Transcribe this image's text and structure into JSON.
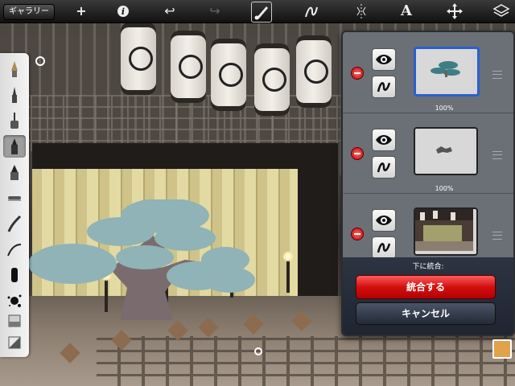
{
  "toolbar": {
    "gallery_label": "ギャラリー",
    "add_glyph": "+",
    "info_glyph": "i",
    "undo_glyph": "↩",
    "redo_glyph": "↪",
    "text_glyph": "A",
    "icons": [
      "plus-icon",
      "info-icon",
      "undo-icon",
      "redo-icon",
      "brush-icon",
      "stroke-icon",
      "symmetry-icon",
      "text-icon",
      "transform-icon",
      "layers-icon"
    ]
  },
  "toolbox": {
    "tools": [
      "pencil",
      "ballpoint",
      "airbrush",
      "marker",
      "paint-brush",
      "smudge",
      "inking-pen",
      "calligraphy",
      "wet-brush",
      "splatter",
      "eraser",
      "fill"
    ],
    "active_tool": "marker"
  },
  "layers": {
    "rows": [
      {
        "opacity": "100%",
        "selected": true,
        "content": "tree"
      },
      {
        "opacity": "100%",
        "selected": false,
        "content": "sketch"
      },
      {
        "opacity": "",
        "selected": false,
        "content": "photo"
      }
    ]
  },
  "merge": {
    "label": "下に統合:",
    "merge_button": "統合する",
    "cancel_button": "キャンセル"
  },
  "colors": {
    "current": "#e2a24a",
    "tree_canopy": "#8fb3b6",
    "tree_trunk": "#7a6c6e",
    "merge_red": "#d20f0f",
    "selected_layer": "#2a5fd0"
  }
}
